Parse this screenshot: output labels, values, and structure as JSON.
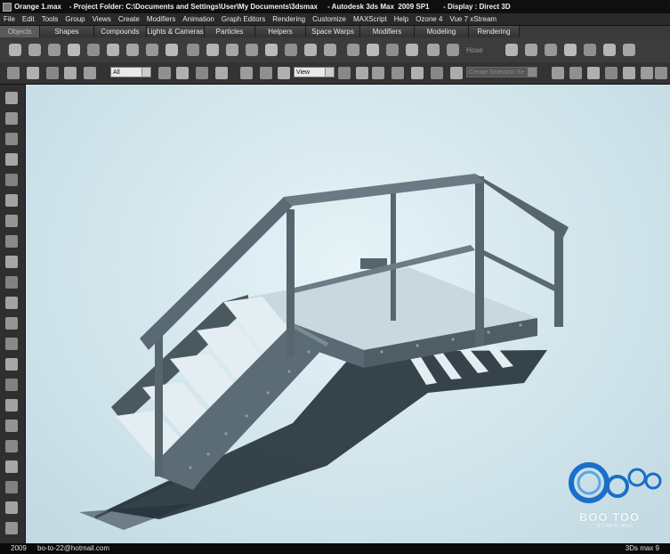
{
  "window": {
    "title": "Orange 1.max    - Project Folder: C:\\Documents and Settings\\User\\My Documents\\3dsmax     - Autodesk 3ds Max  2009 SP1       - Display : Direct 3D"
  },
  "menu": {
    "items": [
      "File",
      "Edit",
      "Tools",
      "Group",
      "Views",
      "Create",
      "Modifiers",
      "Animation",
      "Graph Editors",
      "Rendering",
      "Customize",
      "MAXScript",
      "Help",
      "Ozone 4",
      "Vue 7 xStream"
    ]
  },
  "tabs": {
    "items": [
      "Objects",
      "Shapes",
      "Compounds",
      "Lights & Cameras",
      "Particles",
      "Helpers",
      "Space Warps",
      "Modifiers",
      "Modeling",
      "Rendering"
    ],
    "active_index": 0
  },
  "command_row": {
    "hose_label": "Hose"
  },
  "toolbar": {
    "filter_value": "All",
    "coord_value": "View",
    "selection_set_placeholder": "Create Selection Se"
  },
  "status": {
    "year": "2009",
    "email": "bo-to-22@hotmail.com",
    "app": "3Ds max 9"
  },
  "watermark": {
    "name": "BOO TOO",
    "sub": "STUDIO MAX"
  },
  "colors": {
    "steel": "#5a6a74",
    "steel_dark": "#3b474e",
    "tread": "#dfeaf0",
    "logo_blue": "#1a6fc8"
  }
}
